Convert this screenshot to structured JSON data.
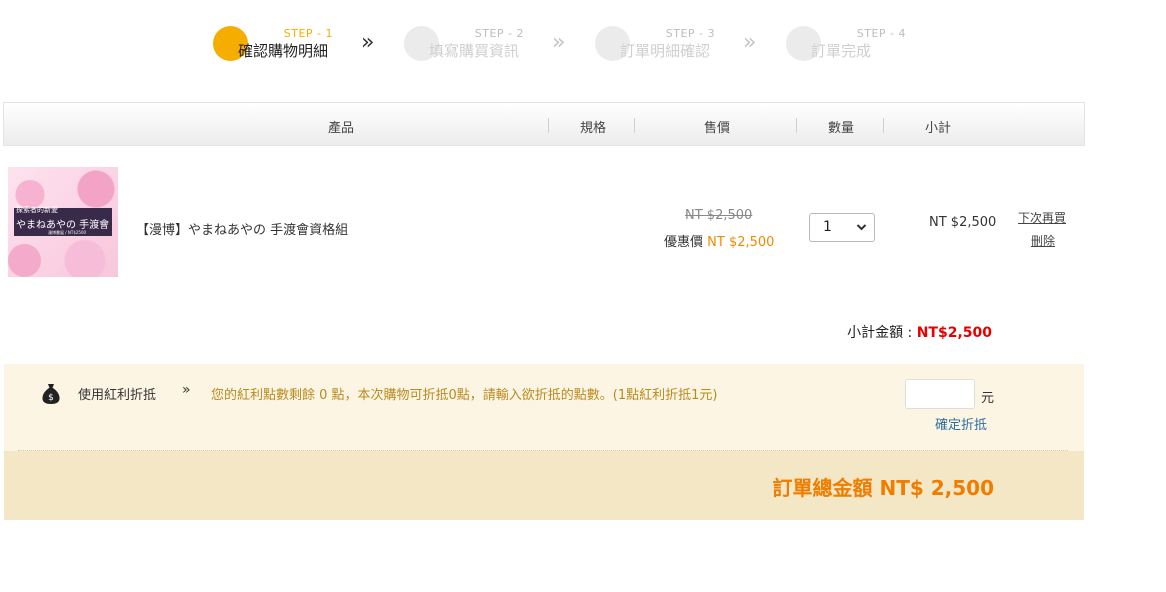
{
  "steps": [
    {
      "num": "STEP - 1",
      "label": "確認購物明細"
    },
    {
      "num": "STEP - 2",
      "label": "填寫購買資訊"
    },
    {
      "num": "STEP - 3",
      "label": "訂單明細確認"
    },
    {
      "num": "STEP - 4",
      "label": "訂單完成"
    }
  ],
  "active_step": 1,
  "step_arrow": "»",
  "table_headers": {
    "product": "產品",
    "spec": "規格",
    "price": "售價",
    "qty": "數量",
    "subtotal": "小計"
  },
  "item": {
    "thumbnail_text": {
      "top": "探索者的新愛",
      "title": "やまねあやの 手渡會",
      "sub": "漫博書展 / NT$2500"
    },
    "name": "【漫博】やまねあやの 手渡會資格組",
    "original_price": "NT $2,500",
    "sale_label": "優惠價",
    "sale_price": "NT $2,500",
    "quantity": "1",
    "subtotal": "NT $2,500",
    "save_later": "下次再買",
    "delete": "刪除"
  },
  "subtotal": {
    "label": "小計金額 : ",
    "value": "NT$2,500"
  },
  "bonus": {
    "icon": "money-bag-icon",
    "title": "使用紅利折抵",
    "arrow": "»",
    "info": "您的紅利點數剩餘 0 點，本次購物可折抵0點，請輸入欲折抵的點數。(1點紅利折抵1元)",
    "input_value": "",
    "unit": "元",
    "apply": "確定折抵"
  },
  "total": {
    "label": "訂單總金額 NT$ 2,500"
  },
  "colors": {
    "accent": "#f5ad00",
    "price_red": "#e60000",
    "orange": "#f07d00",
    "bonus_bg": "#fcf5e4",
    "total_bg": "#f3e7c6"
  }
}
